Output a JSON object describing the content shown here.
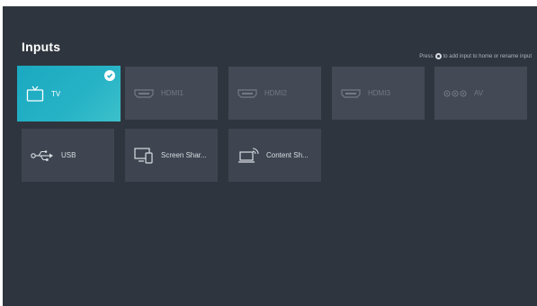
{
  "header": {
    "title": "Inputs",
    "hint": "Press ⏺ to add input to home or rename input",
    "hint_before": "Press",
    "hint_after": "to add input to home or rename input"
  },
  "inputs": [
    {
      "label": "TV",
      "icon": "tv-icon",
      "state": "selected"
    },
    {
      "label": "HDMI1",
      "icon": "hdmi-port-icon",
      "state": "disabled"
    },
    {
      "label": "HDMI2",
      "icon": "hdmi-port-icon",
      "state": "disabled"
    },
    {
      "label": "HDMI3",
      "icon": "hdmi-port-icon",
      "state": "disabled"
    },
    {
      "label": "AV",
      "icon": "av-ports-icon",
      "state": "disabled"
    },
    {
      "label": "USB",
      "icon": "usb-icon",
      "state": "normal"
    },
    {
      "label": "Screen Shar...",
      "icon": "screen-share-icon",
      "state": "normal"
    },
    {
      "label": "Content Sh...",
      "icon": "content-share-icon",
      "state": "normal"
    }
  ],
  "colors": {
    "background": "#2f353e",
    "tile": "#3e4550",
    "tile_disabled": "#434a55",
    "accent": "#1aa9c1"
  }
}
